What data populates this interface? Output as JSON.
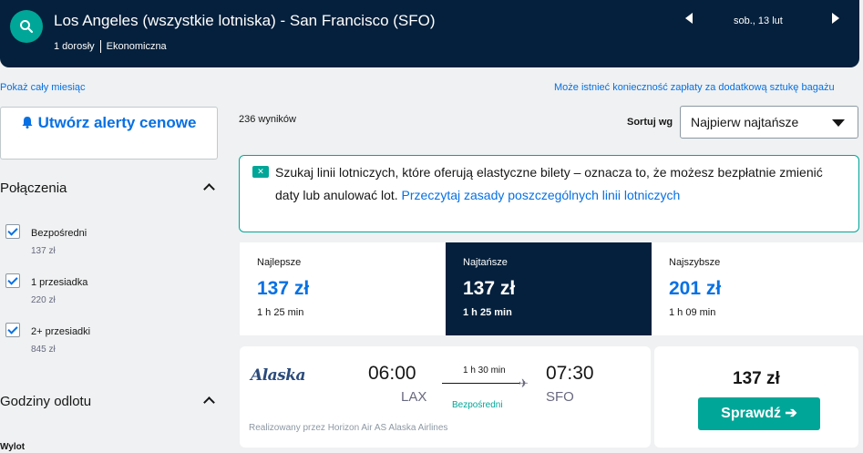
{
  "header": {
    "route": "Los Angeles (wszystkie lotniska) - San Francisco (SFO)",
    "passengers": "1 dorosły",
    "cabin": "Ekonomiczna",
    "date": "sob., 13 lut"
  },
  "links": {
    "show_month": "Pokaż cały miesiąc",
    "baggage_notice": "Może istnieć konieczność zapłaty za dodatkową sztukę bagażu"
  },
  "sidebar": {
    "alert_button": "Utwórz alerty cenowe",
    "connections_title": "Połączenia",
    "connections": [
      {
        "label": "Bezpośredni",
        "price": "137 zł"
      },
      {
        "label": "1 przesiadka",
        "price": "220 zł"
      },
      {
        "label": "2+ przesiadki",
        "price": "845 zł"
      }
    ],
    "departure_title": "Godziny odlotu",
    "departure_sub": "Wylot"
  },
  "results": {
    "count": "236 wyników",
    "sort_label": "Sortuj wg",
    "sort_value": "Najpierw najtańsze"
  },
  "info": {
    "text": "Szukaj linii lotniczych, które oferują elastyczne bilety – oznacza to, że możesz bezpłatnie zmienić daty lub anulować lot. ",
    "link": "Przeczytaj zasady poszczególnych linii lotniczych"
  },
  "tabs": [
    {
      "title": "Najlepsze",
      "price": "137 zł",
      "duration": "1 h 25 min"
    },
    {
      "title": "Najtańsze",
      "price": "137 zł",
      "duration": "1 h 25 min"
    },
    {
      "title": "Najszybsze",
      "price": "201 zł",
      "duration": "1 h 09 min"
    }
  ],
  "flight": {
    "airline": "Alaska",
    "depart_time": "06:00",
    "depart_code": "LAX",
    "arrive_time": "07:30",
    "arrive_code": "SFO",
    "duration": "1 h 30 min",
    "stops": "Bezpośredni",
    "operated_by": "Realizowany przez Horizon Air AS Alaska Airlines",
    "price": "137 zł",
    "select_label": "Sprawdź ➔"
  },
  "colors": {
    "navy": "#05203c",
    "teal": "#00a698",
    "link_blue": "#0770e3"
  }
}
